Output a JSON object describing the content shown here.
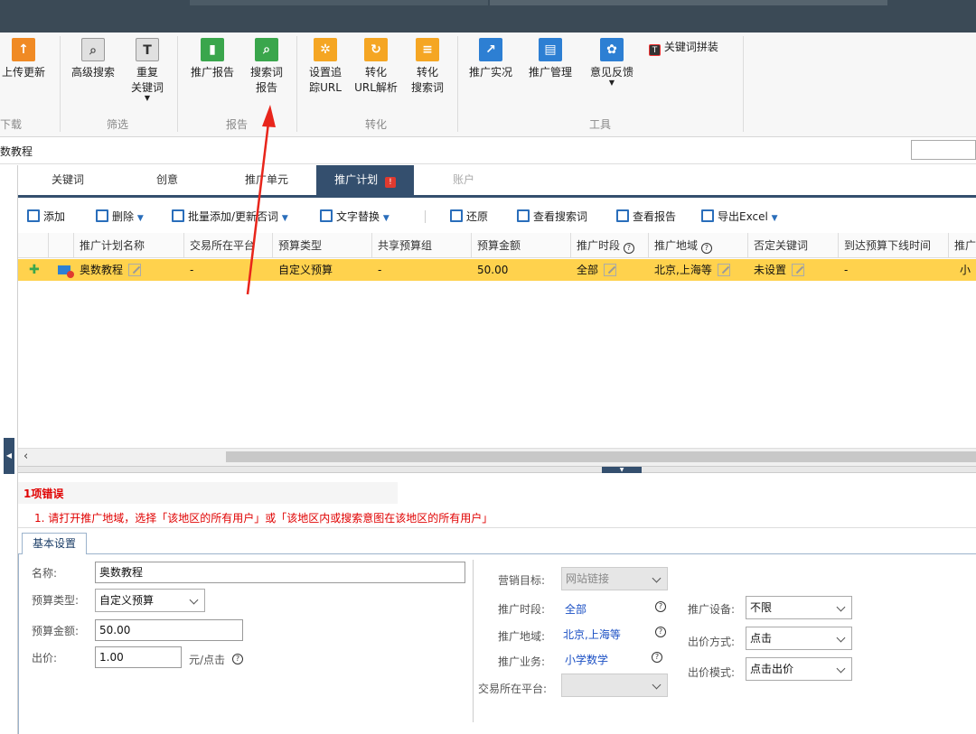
{
  "ribbon": {
    "buttons": [
      {
        "label": "上传更新"
      },
      {
        "label": "高级搜索"
      },
      {
        "label": "重复\n关键词"
      },
      {
        "label": "推广报告"
      },
      {
        "label": "搜索词\n报告"
      },
      {
        "label": "设置追\n踪URL"
      },
      {
        "label": "转化\nURL解析"
      },
      {
        "label": "转化\n搜索词"
      },
      {
        "label": "推广实况"
      },
      {
        "label": "推广管理"
      },
      {
        "label": "意见反馈"
      },
      {
        "label": "关键词拼装"
      }
    ],
    "groups": [
      "下载",
      "筛选",
      "报告",
      "转化",
      "工具"
    ]
  },
  "path": {
    "label": "数教程"
  },
  "tabs": [
    "关键词",
    "创意",
    "推广单元",
    "推广计划",
    "账户"
  ],
  "toolbar": {
    "add": "添加",
    "delete": "删除",
    "batch": "批量添加/更新否词",
    "replace": "文字替换",
    "restore": "还原",
    "view_search": "查看搜索词",
    "view_report": "查看报告",
    "export": "导出Excel"
  },
  "grid": {
    "columns": [
      "推广计划名称",
      "交易所在平台",
      "预算类型",
      "共享预算组",
      "预算金额",
      "推广时段",
      "推广地域",
      "否定关键词",
      "到达预算下线时间",
      "推广"
    ],
    "row": [
      "奥数教程",
      "-",
      "自定义预算",
      "-",
      "50.00",
      "全部",
      "北京,上海等",
      "未设置",
      "-",
      "小"
    ]
  },
  "errors": {
    "head": "1项错误",
    "msg": "1. 请打开推广地域，选择「该地区的所有用户」或「该地区内或搜索意图在该地区的所有用户」"
  },
  "form": {
    "tab": "基本设置",
    "name_label": "名称:",
    "name_value": "奥数教程",
    "budget_type_label": "预算类型:",
    "budget_type_value": "自定义预算",
    "budget_amount_label": "预算金额:",
    "budget_amount_value": "50.00",
    "bid_label": "出价:",
    "bid_value": "1.00",
    "bid_unit": "元/点击",
    "goal_label": "营销目标:",
    "goal_value": "网站链接",
    "time_label": "推广时段:",
    "time_value": "全部",
    "region_label": "推广地域:",
    "region_value": "北京,上海等",
    "business_label": "推广业务:",
    "business_value": "小学数学",
    "platform_label": "交易所在平台:",
    "device_label": "推广设备:",
    "device_value": "不限",
    "bid_method_label": "出价方式:",
    "bid_method_value": "点击",
    "bid_mode_label": "出价模式:",
    "bid_mode_value": "点击出价"
  },
  "colors": {
    "accent": "#344f6e",
    "highlight_row": "#ffd24d",
    "error": "#e00000",
    "arrow": "#e8251b"
  }
}
